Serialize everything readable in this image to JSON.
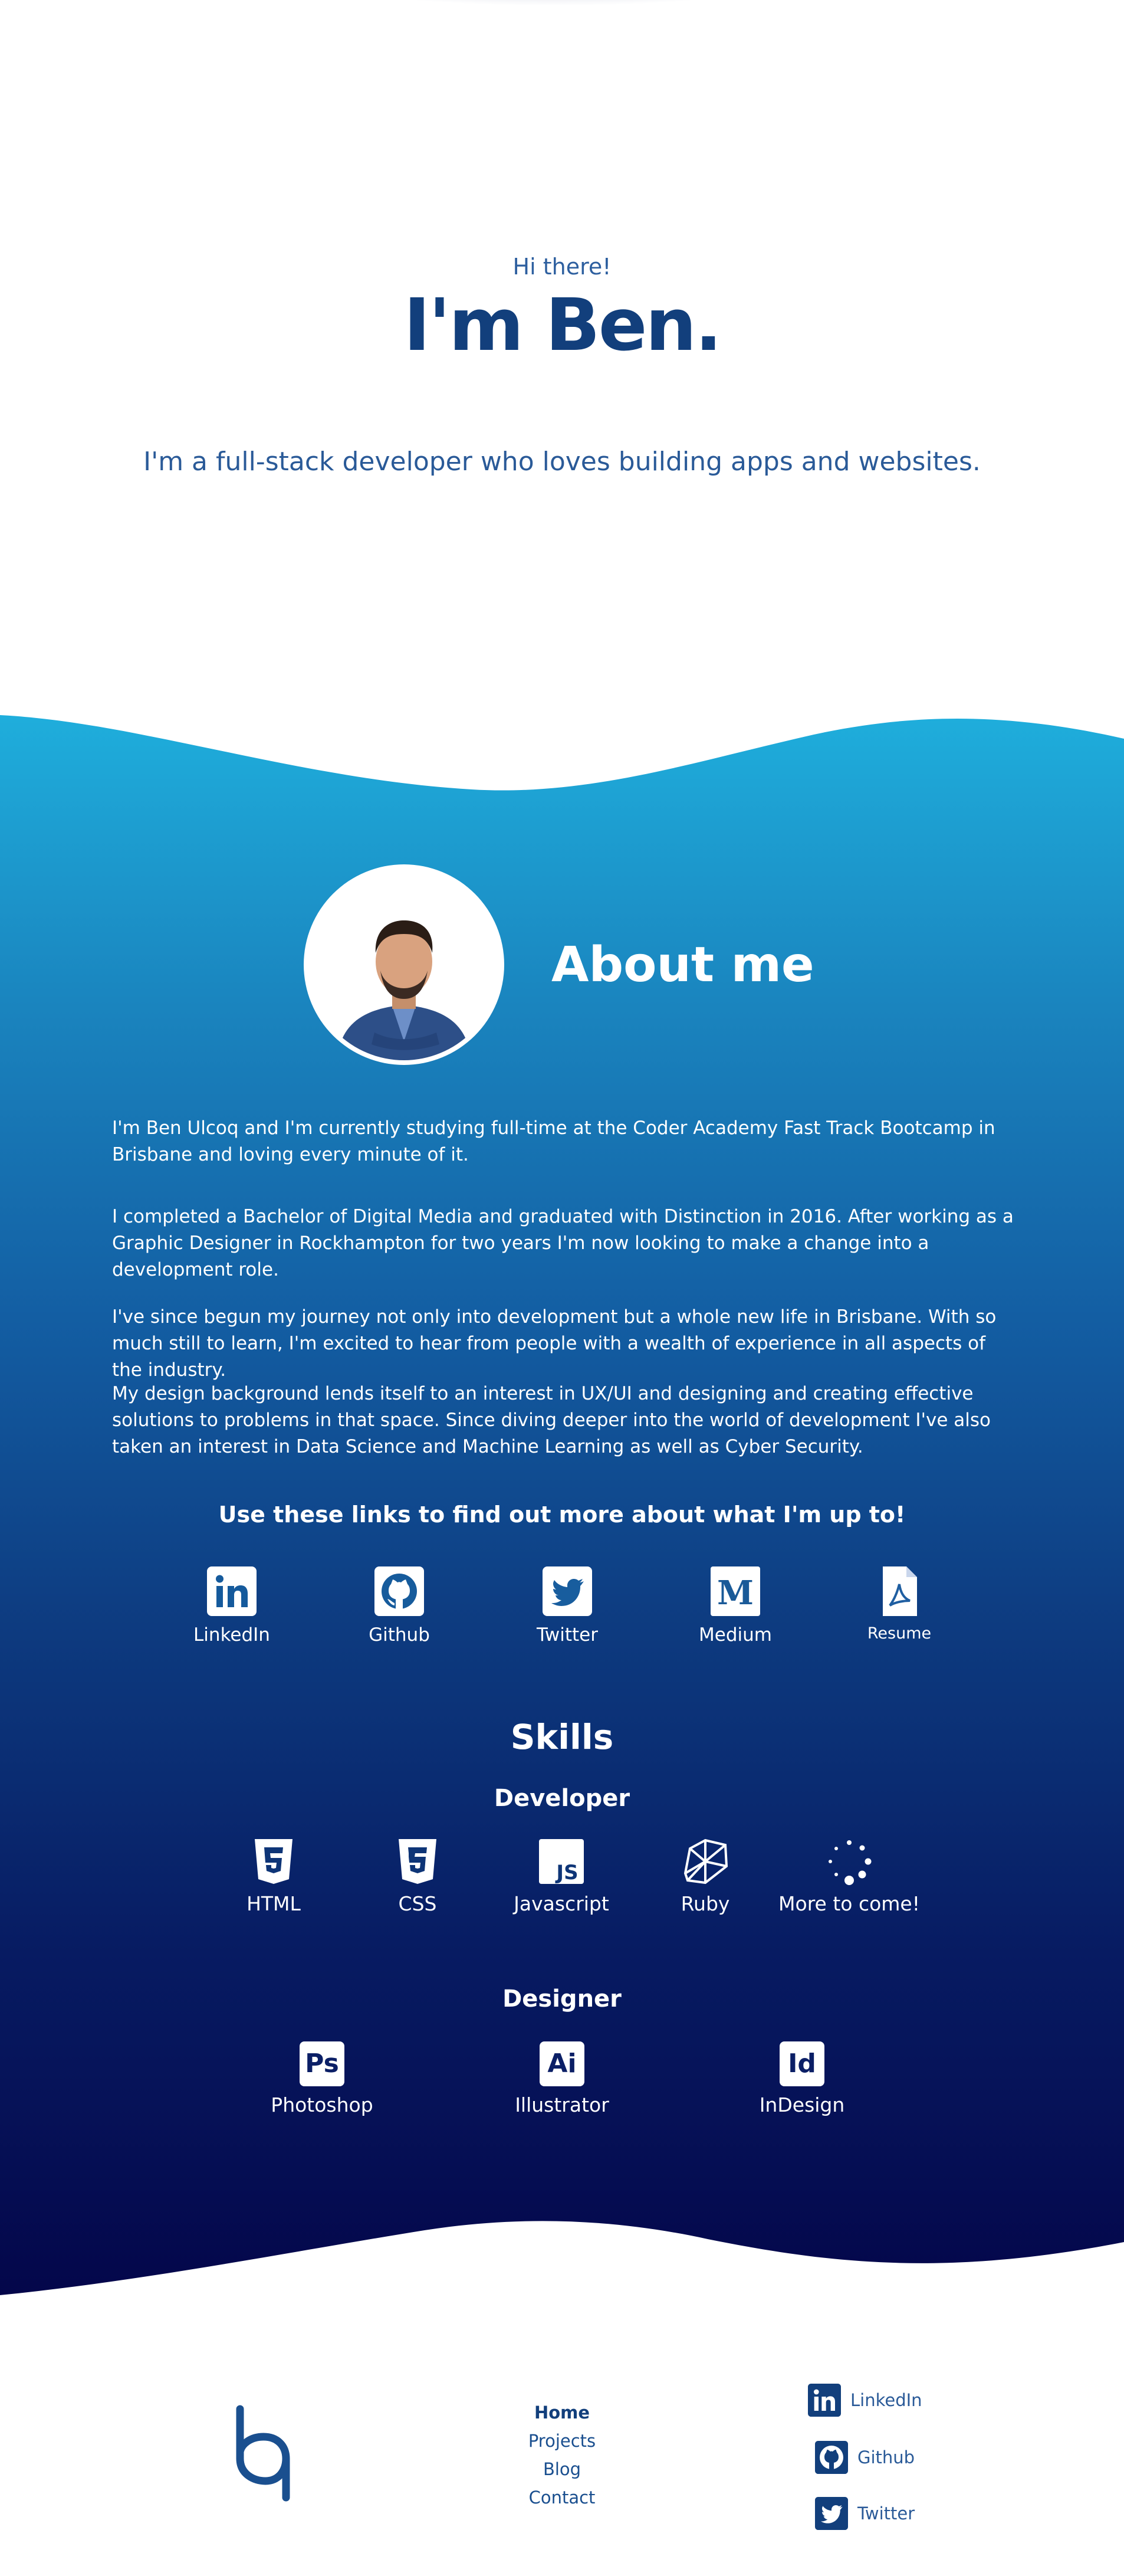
{
  "hero": {
    "greeting": "Hi there!",
    "title": "I'm Ben.",
    "tagline": "I'm a full-stack developer who loves building apps and websites."
  },
  "about": {
    "title": "About me",
    "paragraphs": [
      "I'm Ben Ulcoq and I'm currently studying full-time at the Coder Academy Fast Track Bootcamp in Brisbane and loving every minute of it.",
      "I completed a Bachelor of Digital Media and graduated with Distinction in 2016. After working as a Graphic Designer in Rockhampton for two years I'm now looking to make a change into a development role.",
      "I've since begun my journey not only into development but a whole new life in Brisbane. With so much still to learn, I'm excited to hear from people with a wealth of experience in all aspects of the industry.",
      "My design background lends itself to an interest in UX/UI and designing and creating effective solutions to problems in that space. Since diving deeper into the world of development I've also taken an interest in Data Science and Machine Learning as well as Cyber Security."
    ],
    "links_heading": "Use these links to find out more about what I'm up to!",
    "links": [
      {
        "label": "LinkedIn",
        "icon": "linkedin-icon"
      },
      {
        "label": "Github",
        "icon": "github-icon"
      },
      {
        "label": "Twitter",
        "icon": "twitter-icon"
      },
      {
        "label": "Medium",
        "icon": "medium-icon"
      },
      {
        "label": "Resume",
        "icon": "pdf-icon"
      }
    ]
  },
  "skills": {
    "title": "Skills",
    "developer_heading": "Developer",
    "developer": [
      {
        "label": "HTML",
        "icon": "html5-icon"
      },
      {
        "label": "CSS",
        "icon": "css3-icon"
      },
      {
        "label": "Javascript",
        "icon": "js-icon"
      },
      {
        "label": "Ruby",
        "icon": "ruby-icon"
      },
      {
        "label": "More to come!",
        "icon": "loading-icon"
      }
    ],
    "designer_heading": "Designer",
    "designer": [
      {
        "label": "Photoshop",
        "icon": "photoshop-icon",
        "abbr": "Ps"
      },
      {
        "label": "Illustrator",
        "icon": "illustrator-icon",
        "abbr": "Ai"
      },
      {
        "label": "InDesign",
        "icon": "indesign-icon",
        "abbr": "Id"
      }
    ]
  },
  "footer": {
    "nav": [
      "Home",
      "Projects",
      "Blog",
      "Contact"
    ],
    "social": [
      {
        "label": "LinkedIn",
        "icon": "linkedin-icon"
      },
      {
        "label": "Github",
        "icon": "github-icon"
      },
      {
        "label": "Twitter",
        "icon": "twitter-icon"
      }
    ]
  },
  "colors": {
    "primary": "#123f7c",
    "gradient_top": "#1faedc",
    "gradient_bottom": "#04064a"
  }
}
